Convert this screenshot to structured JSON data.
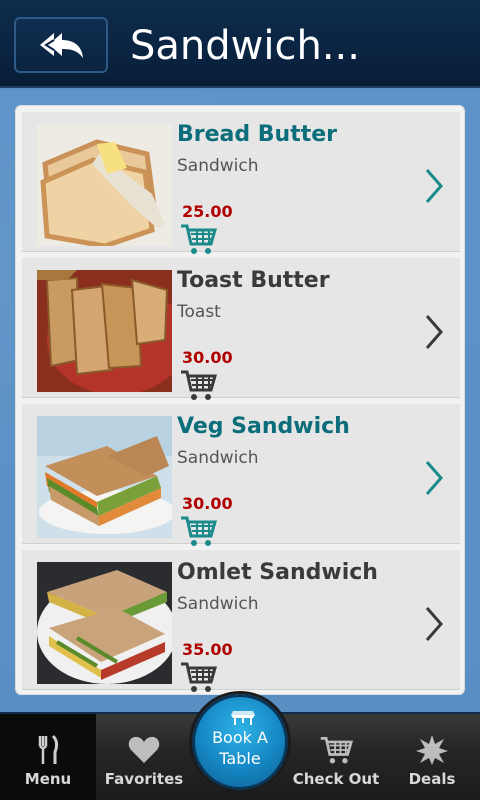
{
  "header": {
    "title": "Sandwich...",
    "back_icon": "double-back-arrow-icon"
  },
  "items": [
    {
      "name": "Bread Butter",
      "category": "Sandwich",
      "price": "25.00",
      "name_color": "#0b6e7a",
      "cart_color": "#1a8a8a",
      "chevron_color": "#1a8a8a",
      "image": "bread-butter-photo"
    },
    {
      "name": "Toast Butter",
      "category": "Toast",
      "price": "30.00",
      "name_color": "#3a3a3a",
      "cart_color": "#3a3a3a",
      "chevron_color": "#3a3a3a",
      "image": "toast-butter-photo"
    },
    {
      "name": "Veg Sandwich",
      "category": "Sandwich",
      "price": "30.00",
      "name_color": "#0b6e7a",
      "cart_color": "#1a8a8a",
      "chevron_color": "#1a8a8a",
      "image": "veg-sandwich-photo"
    },
    {
      "name": "Omlet Sandwich",
      "category": "Sandwich",
      "price": "35.00",
      "name_color": "#3a3a3a",
      "cart_color": "#3a3a3a",
      "chevron_color": "#3a3a3a",
      "image": "omlet-sandwich-photo"
    }
  ],
  "nav": {
    "menu": "Menu",
    "favorites": "Favorites",
    "book_line1": "Book A",
    "book_line2": "Table",
    "checkout": "Check Out",
    "deals": "Deals"
  },
  "colors": {
    "header_bg": "#0a2442",
    "price": "#b00000",
    "accent": "#1587c4"
  }
}
